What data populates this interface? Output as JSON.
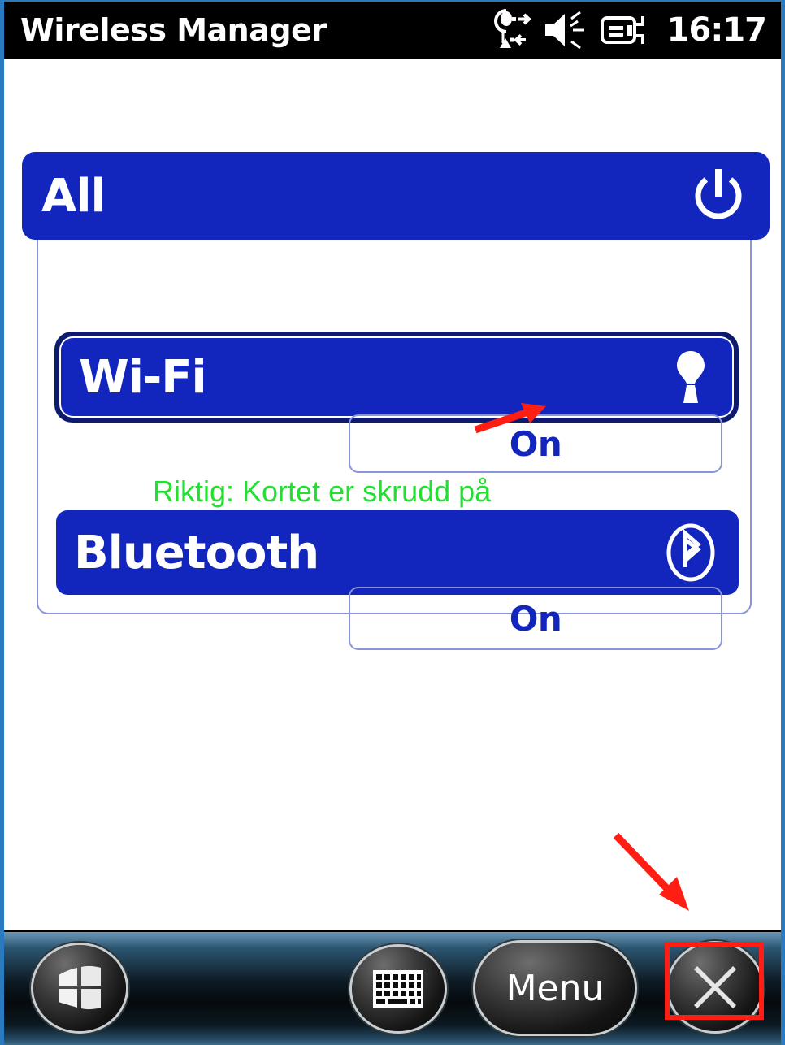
{
  "titlebar": {
    "title": "Wireless Manager",
    "clock": "16:17",
    "icons": [
      {
        "name": "connectivity-sync-icon"
      },
      {
        "name": "volume-speaker-icon"
      },
      {
        "name": "battery-charging-icon"
      }
    ]
  },
  "rows": {
    "all": {
      "label": "All",
      "icon": "power-icon"
    },
    "wifi": {
      "label": "Wi-Fi",
      "icon": "wifi-antenna-icon",
      "status": "On",
      "selected": true
    },
    "bluetooth": {
      "label": "Bluetooth",
      "icon": "bluetooth-icon",
      "status": "On",
      "selected": false
    }
  },
  "annotations": {
    "green_note": "Riktig: Kortet er skrudd på",
    "green_color": "#22E032",
    "arrow_color": "#FF1E14",
    "highlight_color": "#FF1E14",
    "arrow_to_status_label": "arrow-pointing-to-wifi-on-status",
    "arrow_to_close_label": "arrow-pointing-to-close-button"
  },
  "taskbar": {
    "start_label": "start-button",
    "sip_label": "keyboard-input-button",
    "menu_label": "Menu",
    "close_label": "close-button"
  },
  "colors": {
    "accent_blue": "#1226BE",
    "selected_border": "#0E1A6E",
    "panel_border": "#8A94D8",
    "frame_blue": "#2A7AC0",
    "titlebar_bg": "#000000"
  }
}
